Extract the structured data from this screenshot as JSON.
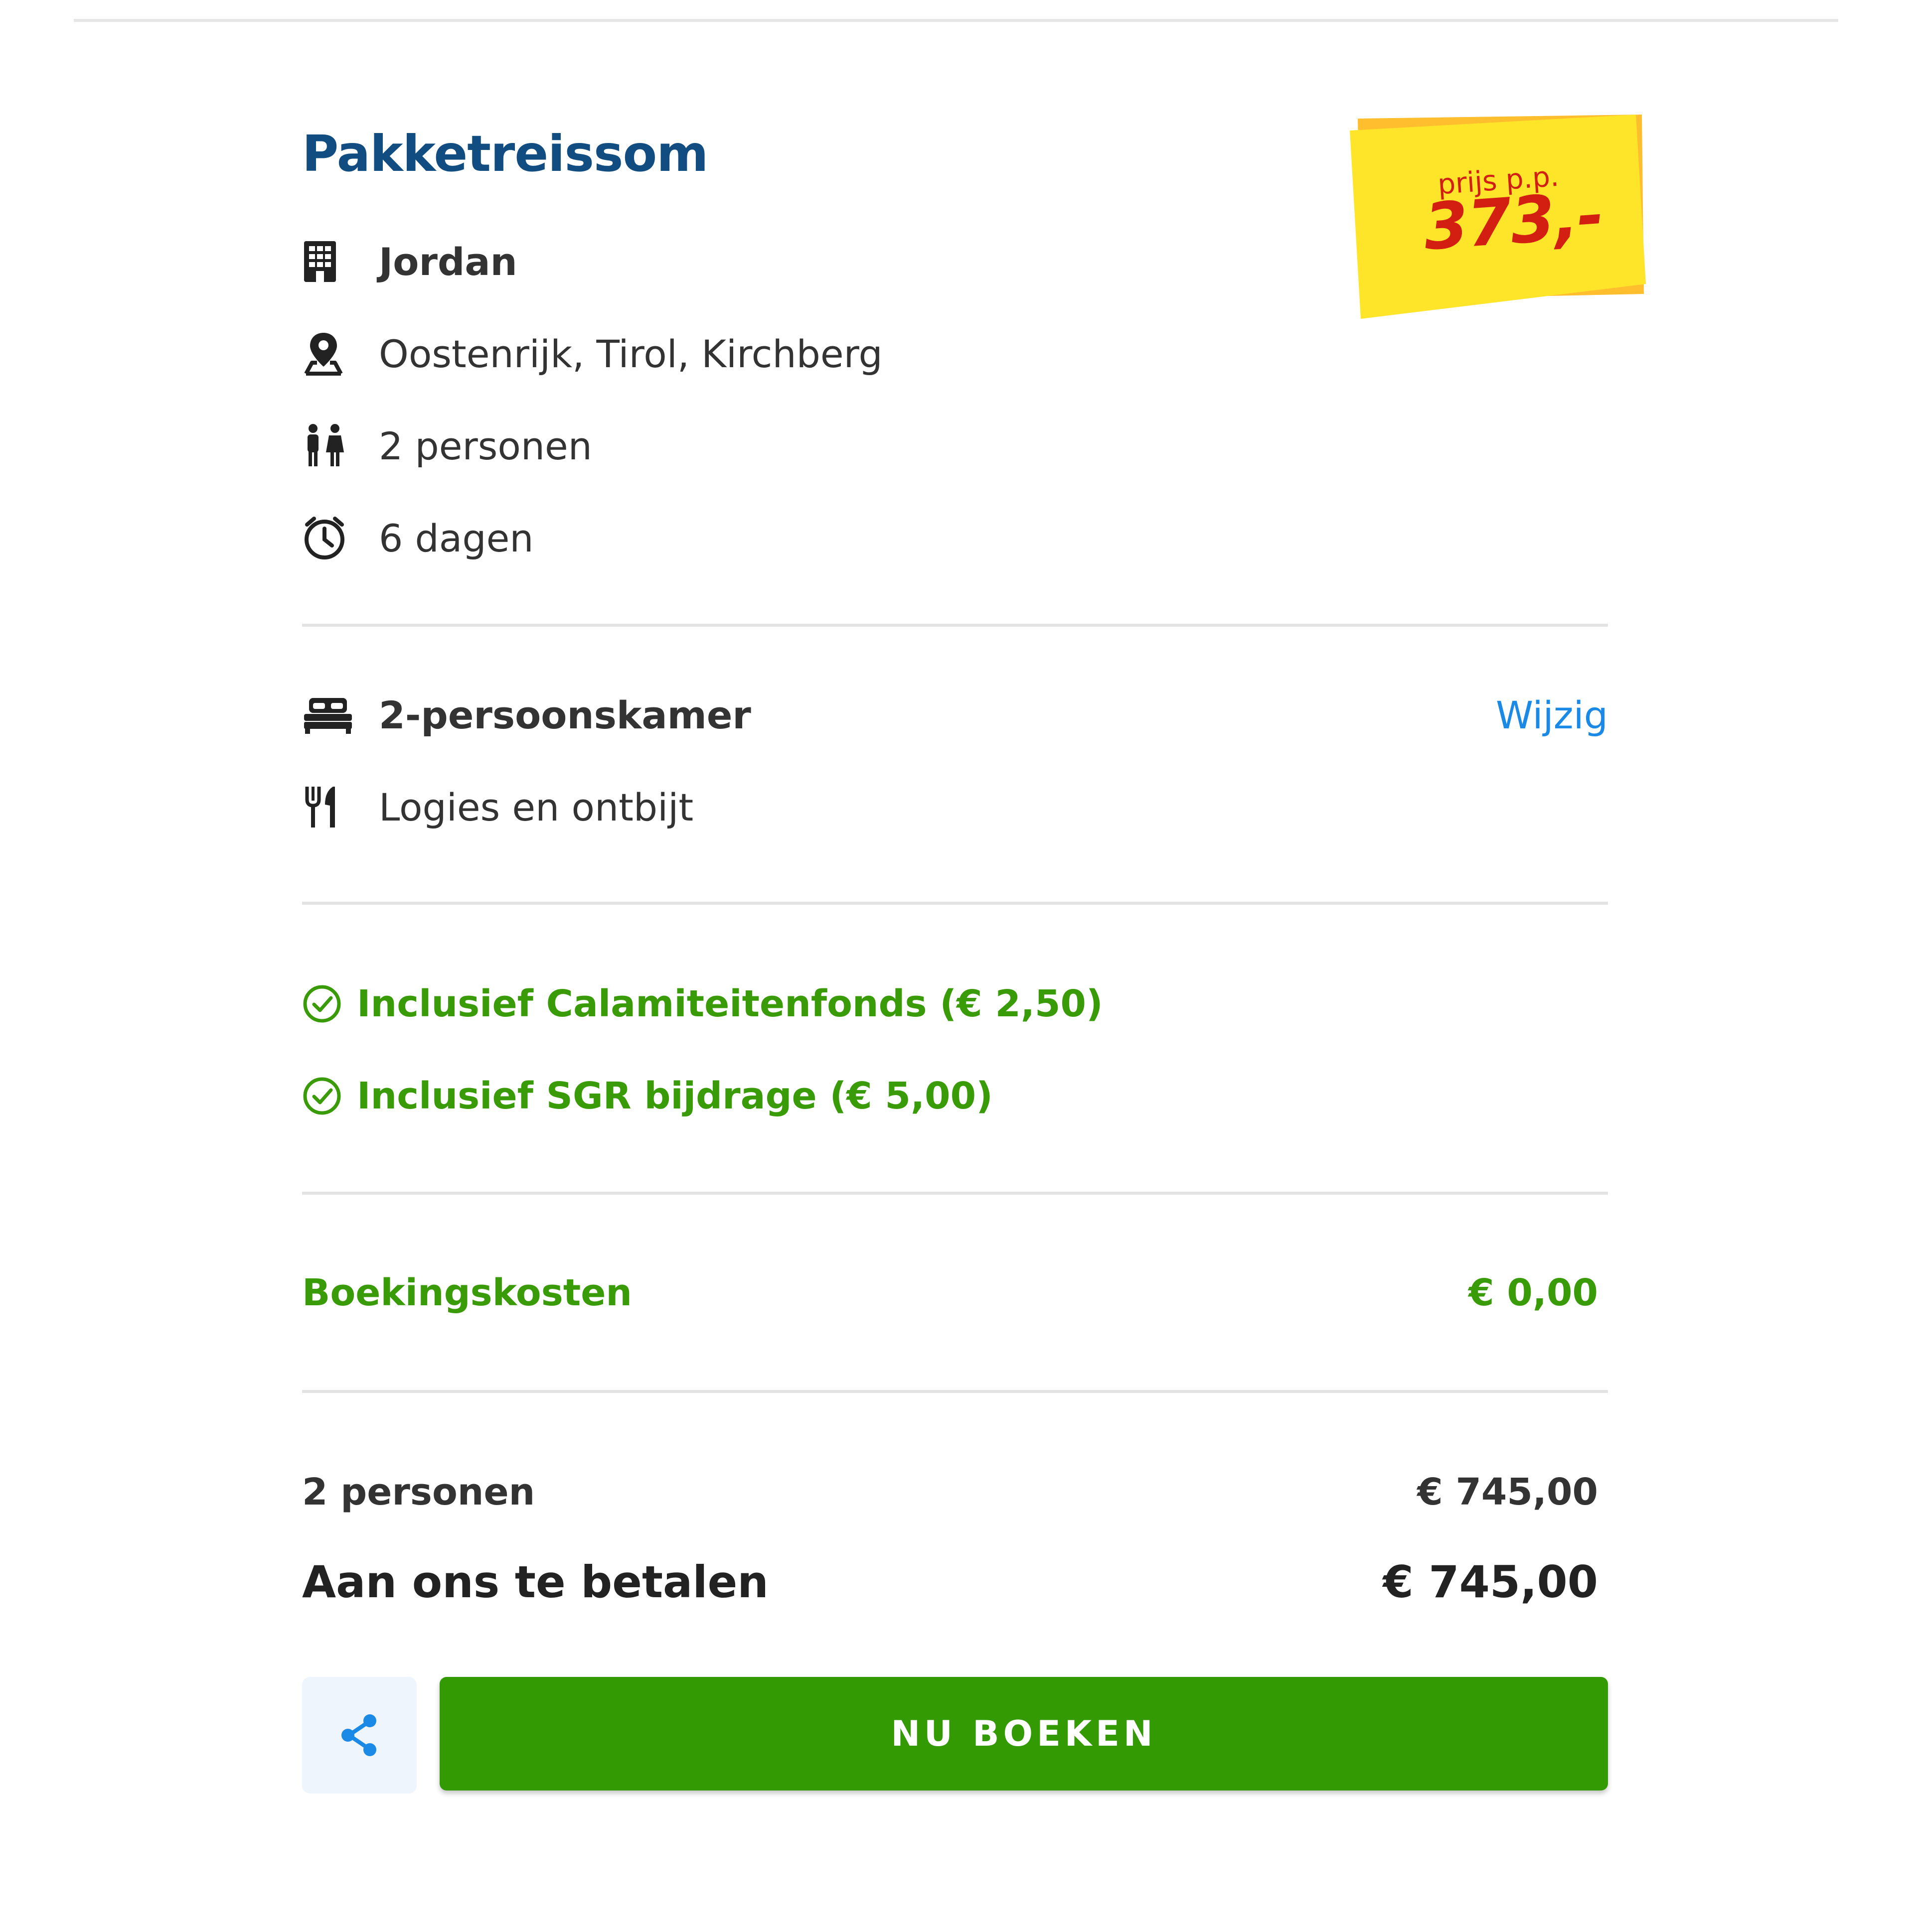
{
  "summary": {
    "title": "Pakketreissom",
    "price_badge": {
      "label": "prijs p.p.",
      "amount": "373,-"
    },
    "details": [
      {
        "icon": "hotel-building-icon",
        "text": "Jordan"
      },
      {
        "icon": "location-pin-icon",
        "text": "Oostenrijk, Tirol, Kirchberg"
      },
      {
        "icon": "persons-icon",
        "text": "2 personen"
      },
      {
        "icon": "clock-icon",
        "text": "6 dagen"
      }
    ],
    "room": {
      "icon": "bed-icon",
      "label": "2-persoonskamer",
      "change_label": "Wijzig"
    },
    "board": {
      "icon": "cutlery-icon",
      "label": "Logies en ontbijt"
    },
    "inclusions": [
      {
        "icon": "check-circle-icon",
        "text": "Inclusief Calamiteitenfonds (€ 2,50)"
      },
      {
        "icon": "check-circle-icon",
        "text": "Inclusief SGR bijdrage (€ 5,00)"
      }
    ],
    "booking_costs": {
      "label": "Boekingskosten",
      "value": "€ 0,00"
    },
    "persons_total": {
      "label": "2 personen",
      "value": "€ 745,00"
    },
    "amount_due": {
      "label": "Aan ons te betalen",
      "value": "€ 745,00"
    },
    "actions": {
      "share_icon": "share-icon",
      "book_label": "NU BOEKEN"
    }
  },
  "colors": {
    "title": "#114d80",
    "green": "#3a9b09",
    "button": "#349a04",
    "link": "#1a8ae6",
    "price": "#d31f12",
    "sticker": "#ffe52a",
    "sticker_shadow": "#ffbe2e"
  }
}
